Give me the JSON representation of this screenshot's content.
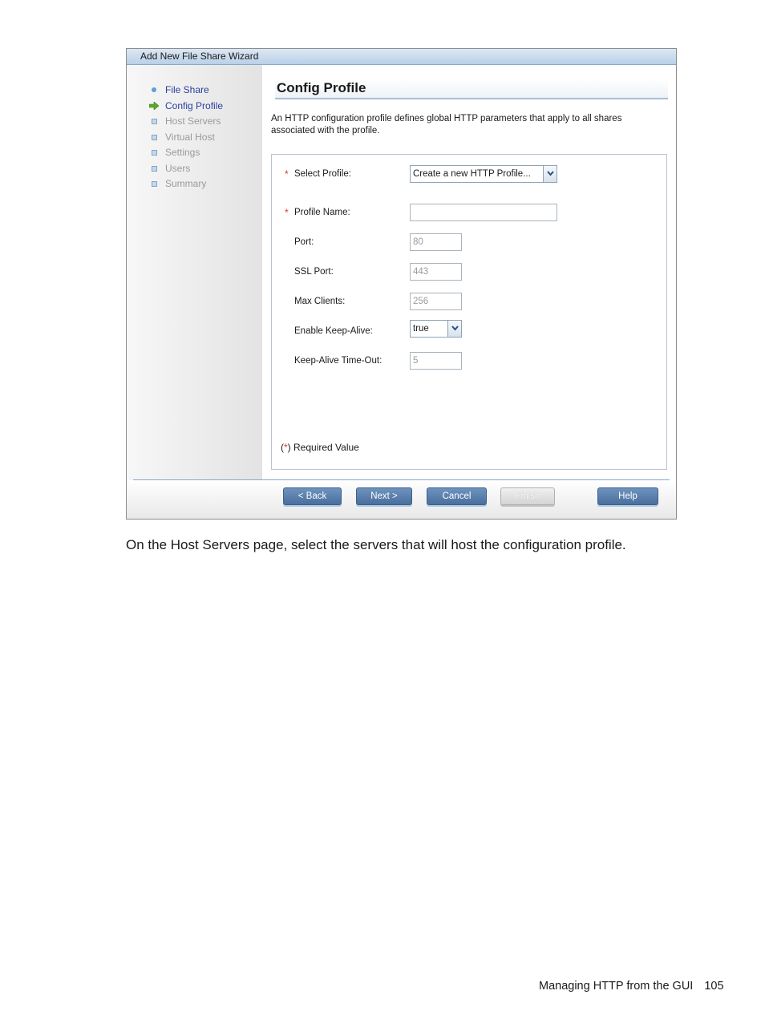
{
  "wizard": {
    "title": "Add New File Share Wizard",
    "steps": [
      {
        "label": "File Share",
        "state": "done",
        "icon": "bullet-dot-icon"
      },
      {
        "label": "Config Profile",
        "state": "current",
        "icon": "green-arrow-icon"
      },
      {
        "label": "Host Servers",
        "state": "pending",
        "icon": "square-bullet-icon"
      },
      {
        "label": "Virtual Host",
        "state": "pending",
        "icon": "square-bullet-icon"
      },
      {
        "label": "Settings",
        "state": "pending",
        "icon": "square-bullet-icon"
      },
      {
        "label": "Users",
        "state": "pending",
        "icon": "square-bullet-icon"
      },
      {
        "label": "Summary",
        "state": "pending",
        "icon": "square-bullet-icon"
      }
    ],
    "page_title": "Config Profile",
    "description": "An HTTP configuration profile defines global HTTP parameters that apply to all shares associated with the profile.",
    "form": {
      "select_profile": {
        "label": "Select Profile:",
        "required": "*",
        "value": "Create a new HTTP Profile..."
      },
      "profile_name": {
        "label": "Profile Name:",
        "required": "*",
        "value": ""
      },
      "port": {
        "label": "Port:",
        "value": "80"
      },
      "ssl_port": {
        "label": "SSL Port:",
        "value": "443"
      },
      "max_clients": {
        "label": "Max Clients:",
        "value": "256"
      },
      "enable_keep_alive": {
        "label": "Enable Keep-Alive:",
        "value": "true"
      },
      "keep_alive_timeout": {
        "label": "Keep-Alive Time-Out:",
        "value": "5"
      }
    },
    "required_note": {
      "open": "(",
      "star": "*",
      "close": ") Required Value"
    },
    "buttons": {
      "back": "< Back",
      "next": "Next >",
      "cancel": "Cancel",
      "finish": "Finish",
      "help": "Help"
    }
  },
  "caption": "On the Host Servers page, select the servers that will host the configuration profile.",
  "footer": {
    "section": "Managing HTTP from the GUI",
    "page_number": "105"
  },
  "colors": {
    "link_blue": "#2a3fa0",
    "required_red": "#e03030",
    "button_blue": "#4a6f9c"
  }
}
